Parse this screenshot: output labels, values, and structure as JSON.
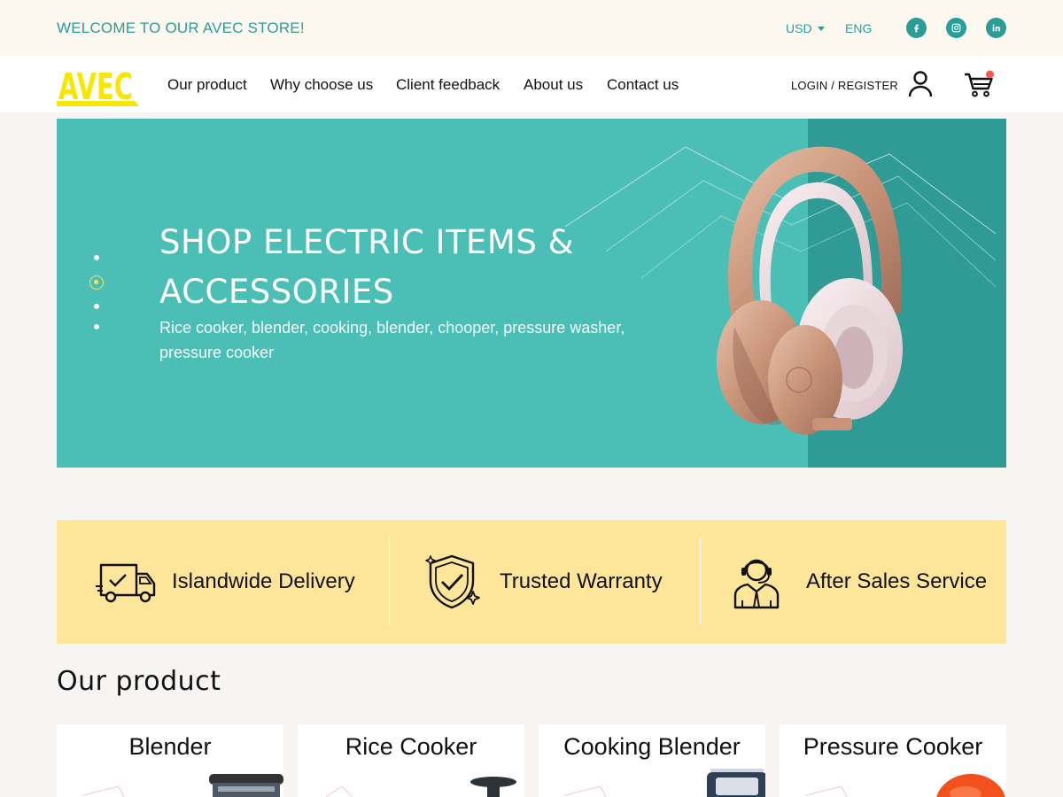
{
  "topbar": {
    "welcome": "WELCOME TO OUR AVEC STORE!",
    "currency": "USD",
    "language": "ENG",
    "social": [
      "facebook-icon",
      "instagram-icon",
      "linkedin-icon"
    ],
    "accent_color": "#2a9d96"
  },
  "nav": {
    "logo_text": "AVEC",
    "items": [
      {
        "label": "Our product"
      },
      {
        "label": "Why choose us"
      },
      {
        "label": "Client feedback"
      },
      {
        "label": "About us"
      },
      {
        "label": "Contact us"
      }
    ],
    "login_label": "LOGIN / REGISTER",
    "cart_badge_color": "#f05a4f"
  },
  "hero": {
    "title": "SHOP ELECTRIC ITEMS & ACCESSORIES",
    "subtitle": "Rice cooker, blender, cooking, blender, chooper, pressure washer, pressure cooker",
    "slide_count": 4,
    "active_slide": 2,
    "bg_color": "#4bbfb6",
    "bg_dark_color": "#309a94",
    "image": "headphones-image"
  },
  "features": {
    "bg_color": "#fde59a",
    "items": [
      {
        "label": "Islandwide Delivery",
        "icon": "delivery-truck-icon"
      },
      {
        "label": "Trusted Warranty",
        "icon": "shield-check-icon"
      },
      {
        "label": "After Sales Service",
        "icon": "support-agent-icon"
      }
    ]
  },
  "products": {
    "section_title": "Our product",
    "items": [
      {
        "title": "Blender"
      },
      {
        "title": "Rice Cooker"
      },
      {
        "title": "Cooking Blender"
      },
      {
        "title": "Pressure Cooker"
      }
    ]
  }
}
